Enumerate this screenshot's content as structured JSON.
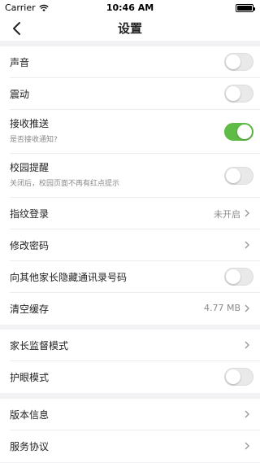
{
  "status_bar": {
    "carrier": "Carrier",
    "time": "10:46 AM"
  },
  "nav": {
    "title": "设置"
  },
  "settings": {
    "sound": {
      "label": "声音",
      "enabled": false
    },
    "vibration": {
      "label": "震动",
      "enabled": false
    },
    "push": {
      "label": "接收推送",
      "sub": "是否接收通知?",
      "enabled": true
    },
    "campus_remind": {
      "label": "校园提醒",
      "sub": "关闭后，校园页面不再有红点提示",
      "enabled": false
    },
    "fingerprint": {
      "label": "指纹登录",
      "value": "未开启"
    },
    "change_password": {
      "label": "修改密码"
    },
    "hide_contacts": {
      "label": "向其他家长隐藏通讯录号码",
      "enabled": false
    },
    "clear_cache": {
      "label": "清空缓存",
      "value": "4.77 MB"
    },
    "parental_mode": {
      "label": "家长监督模式"
    },
    "eye_care": {
      "label": "护眼模式",
      "enabled": false
    },
    "version": {
      "label": "版本信息"
    },
    "terms": {
      "label": "服务协议"
    }
  },
  "colors": {
    "toggle_on": "#5dbb46",
    "background": "#f2f2f4"
  }
}
